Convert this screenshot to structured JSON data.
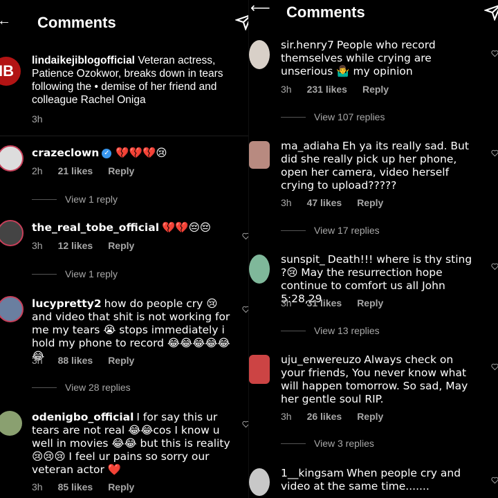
{
  "left": {
    "title": "Comments",
    "caption": {
      "avatar_text": "IB",
      "username": "lindaikejiblogofficial",
      "text": "Veteran actress, Patience Ozokwor, breaks down in tears following the • demise of her friend and colleague Rachel Oniga",
      "time": "3h"
    },
    "comments": [
      {
        "user": "crazeclown",
        "text": "💔💔💔😢",
        "time": "2h",
        "likes": "21 likes",
        "reply": "Reply",
        "replies": "View 1 reply",
        "verified": true
      },
      {
        "user": "the_real_tobe_official",
        "text": "💔💔😔😔",
        "time": "3h",
        "likes": "12 likes",
        "reply": "Reply",
        "replies": "View 1 reply"
      },
      {
        "user": "lucypretty2",
        "text": "how do people cry 😢 and video that shit is not working for me my tears 😭 stops immediately i hold my phone to record 😂😂😂😂😂😂",
        "time": "3h",
        "likes": "88 likes",
        "reply": "Reply",
        "replies": "View 28 replies"
      },
      {
        "user": "odenigbo_official",
        "text": "I for say this ur tears are not real 😂😂cos I know u well in movies 😂😂 but this is reality 😢😢😢 I feel ur pains so sorry our veteran actor ❤️",
        "time": "3h",
        "likes": "85 likes",
        "reply": "Reply"
      }
    ]
  },
  "right": {
    "title": "Comments",
    "comments": [
      {
        "user": "sir.henry7",
        "text": "People who record themselves while crying are unserious 🤷‍♂️ my opinion",
        "time": "3h",
        "likes": "231 likes",
        "reply": "Reply",
        "replies": "View 107 replies"
      },
      {
        "user": "ma_adiaha",
        "text": "Eh ya its really sad. But did she really pick up her phone, open her camera, video herself crying to upload?????",
        "time": "3h",
        "likes": "47 likes",
        "reply": "Reply",
        "replies": "View 17 replies"
      },
      {
        "user": "sunspit_",
        "text": "Death!!! where is thy sting ?😢 May the resurrection hope continue to comfort us all John 5:28,29",
        "time": "3h",
        "likes": "31 likes",
        "reply": "Reply",
        "replies": "View 13 replies"
      },
      {
        "user": "uju_enwereuzo",
        "text": "Always check on your friends, You never know what will happen tomorrow. So sad, May her gentle soul RIP.",
        "time": "3h",
        "likes": "26 likes",
        "reply": "Reply",
        "replies": "View 3 replies"
      },
      {
        "user": "1__kingsam",
        "text": "When people cry and video at the same time.......",
        "time": "",
        "likes": "",
        "reply": ""
      }
    ]
  },
  "colors": {
    "background": "#000000",
    "muted": "#a8a8a8",
    "verified": "#3897f0",
    "caption_avatar": "#b21414",
    "story_ring": "#c7405a"
  }
}
